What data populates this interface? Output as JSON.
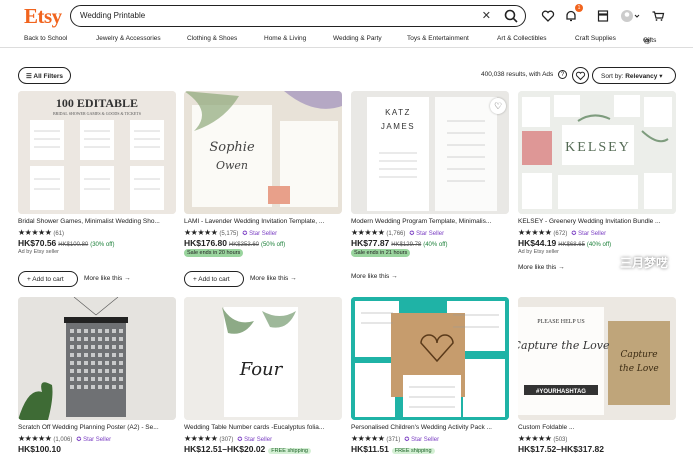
{
  "header": {
    "logo": "Etsy",
    "search_value": "Wedding Printable",
    "clear_symbol": "✕",
    "notification_count": "1"
  },
  "nav": [
    "Back to School",
    "Jewelry & Accessories",
    "Clothing & Shoes",
    "Home & Living",
    "Wedding & Party",
    "Toys & Entertainment",
    "Art & Collectibles",
    "Craft Supplies",
    "Gifts"
  ],
  "toolbar": {
    "filters_label": "All Filters",
    "results_text": "400,038 results, with Ads",
    "sort_prefix": "Sort by:",
    "sort_value": "Relevancy"
  },
  "cards": [
    {
      "title": "Bridal Shower Games, Minimalist Wedding Sho...",
      "stars": "★★★★★",
      "reviews": "(61)",
      "price": "HK$70.56",
      "orig": "HK$100.80",
      "off": "(30% off)",
      "ad": "Ad by Etsy seller",
      "add_to_cart": "Add to cart",
      "more": "More like this →",
      "thumb_text": "100 EDITABLE"
    },
    {
      "title": "LAMI - Lavender Wedding Invitation Template, ...",
      "stars": "★★★★★",
      "reviews": "(5,175)",
      "star_seller": "Star Seller",
      "price": "HK$176.80",
      "orig": "HK$353.60",
      "off": "(50% off)",
      "sale": "Sale ends in 20 hours",
      "add_to_cart": "Add to cart",
      "more": "More like this →"
    },
    {
      "title": "Modern Wedding Program Template, Minimalis...",
      "stars": "★★★★★",
      "reviews": "(1,766)",
      "star_seller": "Star Seller",
      "price": "HK$77.87",
      "orig": "HK$129.78",
      "off": "(40% off)",
      "sale": "Sale ends in 21 hours",
      "more": "More like this →",
      "thumb_name1": "KATZ",
      "thumb_name2": "JAMES"
    },
    {
      "title": "KELSEY - Greenery Wedding Invitation Bundle ...",
      "stars": "★★★★★",
      "reviews": "(672)",
      "star_seller": "Star Seller",
      "price": "HK$44.19",
      "orig": "HK$68.65",
      "off": "(40% off)",
      "ad": "Ad by Etsy seller",
      "more": "More like this →",
      "thumb_text": "KELSEY"
    },
    {
      "title": "Scratch Off Wedding Planning Poster (A2) - Se...",
      "stars": "★★★★★",
      "reviews": "(1,006)",
      "star_seller": "Star Seller",
      "price": "HK$100.10"
    },
    {
      "title": "Wedding Table Number cards -Eucalyptus folia...",
      "stars": "★★★★★",
      "reviews": "(307)",
      "star_seller": "Star Seller",
      "price": "HK$12.51–HK$20.02",
      "free_ship": "FREE shipping",
      "thumb_text": "Four"
    },
    {
      "title": "Personalised Children's Wedding Activity Pack ...",
      "stars": "★★★★★",
      "reviews": "(371)",
      "star_seller": "Star Seller",
      "price": "HK$11.51",
      "free_ship": "FREE shipping"
    },
    {
      "title": "Custom Foldable ...",
      "stars": "★★★★★",
      "reviews": "(503)",
      "price": "HK$17.52–HK$317.82",
      "thumb_text1": "PLEASE HELP US",
      "thumb_text2": "Capture the Love",
      "thumb_text3": "#YOURHASHTAG",
      "watermark": "三月梦呓"
    }
  ],
  "colors": {
    "brand": "#f1641e",
    "star_seller": "#7b3fc3",
    "sale_bg": "#9ad59e"
  }
}
